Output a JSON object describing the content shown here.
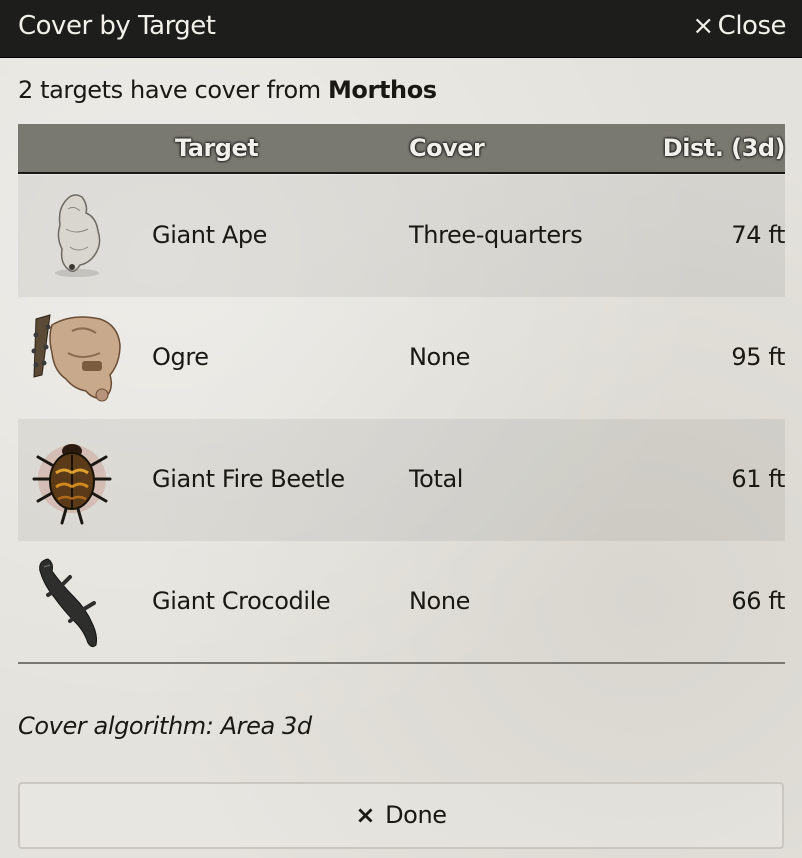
{
  "window": {
    "title": "Cover by Target",
    "close_icon": "×",
    "close_label": "Close"
  },
  "summary": {
    "prefix": "2 targets have cover from ",
    "source": "Morthos"
  },
  "table": {
    "headers": [
      "Target",
      "Cover",
      "Dist. (3d)"
    ],
    "rows": [
      {
        "icon": "giant-ape-token",
        "name": "Giant Ape",
        "cover": "Three-quarters",
        "distance": "74 ft"
      },
      {
        "icon": "ogre-token",
        "name": "Ogre",
        "cover": "None",
        "distance": "95 ft"
      },
      {
        "icon": "giant-fire-beetle-token",
        "name": "Giant Fire Beetle",
        "cover": "Total",
        "distance": "61 ft"
      },
      {
        "icon": "giant-crocodile-token",
        "name": "Giant Crocodile",
        "cover": "None",
        "distance": "66 ft"
      }
    ]
  },
  "footer": {
    "algorithm": "Cover algorithm: Area 3d",
    "done_icon": "×",
    "done_label": "Done"
  },
  "colors": {
    "titlebar": "#1d1d1c",
    "header_bg": "#7a7971",
    "text": "#191813"
  }
}
